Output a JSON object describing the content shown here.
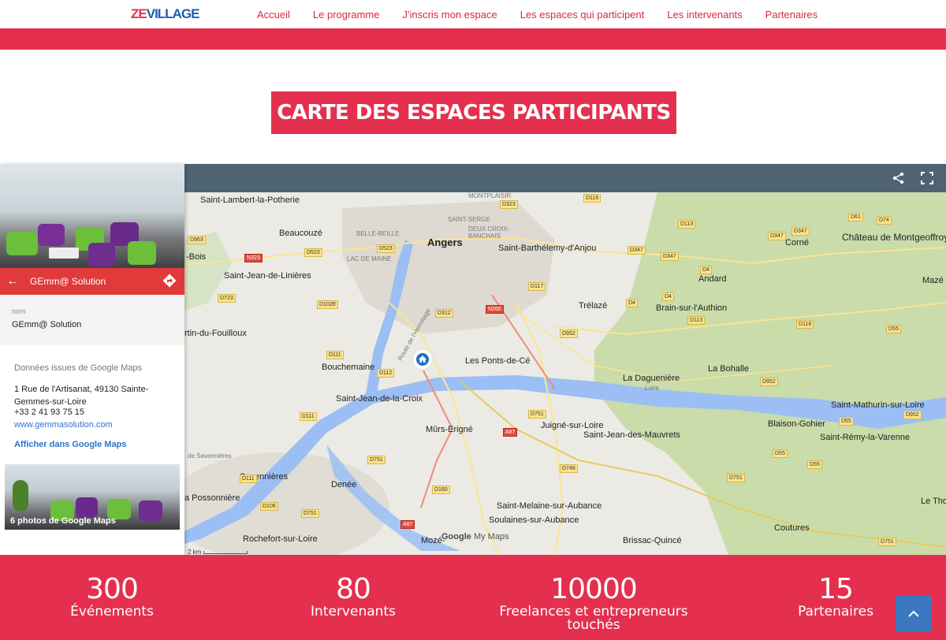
{
  "nav": {
    "logo_left": "ZE",
    "logo_right": "VILLAGE",
    "items": [
      {
        "label": "Accueil"
      },
      {
        "label": "Le programme"
      },
      {
        "label": "J'inscris mon espace"
      },
      {
        "label": "Les espaces qui participent"
      },
      {
        "label": "Les intervenants"
      },
      {
        "label": "Partenaires"
      }
    ]
  },
  "title": "CARTE DES ESPACES PARTICIPANTS",
  "map": {
    "toolbar": {
      "share_icon": "share-icon",
      "fullscreen_icon": "fullscreen-icon"
    },
    "google_logo": "Google",
    "my_maps": "My Maps",
    "scale": "2 km",
    "labels": {
      "angers": "Angers",
      "montplaisir": "MONTPLAISIR",
      "saint_serge": "SAINT-SERGE",
      "deux_croix": "DEUX CROIX-BANCHAIS",
      "belle_beille": "BELLE-BEILLE",
      "lac_de_maine": "LAC DE MAINE",
      "saint_lambert": "Saint-Lambert-la-Potherie",
      "beaucouze": "Beaucouzé",
      "bois": "-Bois",
      "saint_jean_lin": "Saint-Jean-de-Linières",
      "rtin_fouilloux": "rtin-du-Fouilloux",
      "bouchemaine": "Bouchemaine",
      "saint_jean_croix": "Saint-Jean-de-la-Croix",
      "savennieres": "Savennières",
      "possonniere": "a Possonnière",
      "rochefort": "Rochefort-sur-Loire",
      "denee": "Denée",
      "murs": "Mûrs-Erigné",
      "juigne": "Juigné-sur-Loire",
      "ponts_de_ce": "Les Ponts-de-Cé",
      "saint_barth": "Saint-Barthélemy-d'Anjou",
      "trelaze": "Trélazé",
      "saint_jean_mauvrets": "Saint-Jean-des-Mauvrets",
      "saint_melaine": "Saint-Melaine-sur-Aubance",
      "soulaines": "Soulaines-sur-Aubance",
      "moze": "Mozé-",
      "brissac": "Brissac-Quincé",
      "coutures": "Coutures",
      "blaison": "Blaison-Gohier",
      "saint_remy": "Saint-Rémy-la-Varenne",
      "saint_mathurin": "Saint-Mathurin-sur-Loire",
      "la_bohalle": "La Bohalle",
      "la_daguenieres": "La Daguenière",
      "brain": "Brain-sur-l'Authion",
      "andard": "Andard",
      "corne": "Corné",
      "montgeoffroy": "Château de Montgeoffroy",
      "maze": "Mazé",
      "le_thoure": "Le Thoure",
      "route_hermitage": "Route de l'Hermitage",
      "loire": "Loire",
      "sur_savennieres": "de Savennières"
    },
    "roads": {
      "d963": "D963",
      "n323": "N323",
      "d523a": "D523",
      "d523b": "D523",
      "d323": "D323",
      "d116": "D116",
      "d113a": "D113",
      "d113b": "D113",
      "d347a": "D347",
      "d347b": "D347",
      "d347c": "D347",
      "d347d": "D347",
      "d61": "D61",
      "d74": "D74",
      "d723": "D723",
      "d102e": "D102E",
      "d312": "D312",
      "n260": "N260",
      "d117": "D117",
      "d952a": "D952",
      "d4a": "D4",
      "d4b": "D4",
      "d4c": "D4",
      "d118": "D118",
      "d55a": "D55",
      "d55b": "D55",
      "d55c": "D55",
      "d55d": "D55",
      "d111a": "D111",
      "d111b": "D111",
      "d111c": "D111",
      "d112": "D112",
      "d751a": "D751",
      "d751b": "D751",
      "d751c": "D751",
      "d751d": "D751",
      "d751e": "D751",
      "a87a": "A87",
      "a87b": "A87",
      "d748": "D748",
      "d160": "D160",
      "d106": "D106",
      "d952b": "D952",
      "d952c": "D952"
    }
  },
  "panel": {
    "name": "GEmm@ Solution",
    "field_label": "nom",
    "field_value": "GEmm@ Solution",
    "source": "Données issues de Google Maps",
    "address": "1 Rue de l'Artisanat, 49130 Sainte-Gemmes-sur-Loire",
    "phone": "+33 2 41 93 75 15",
    "website": "www.gemmasolution.com",
    "gmaps_link": "Afficher dans Google Maps",
    "photos": "6 photos de Google Maps"
  },
  "stats": [
    {
      "number": "300",
      "label": "Événements"
    },
    {
      "number": "80",
      "label": "Intervenants"
    },
    {
      "number": "10000",
      "label": "Freelances et entrepreneurs touchés"
    },
    {
      "number": "15",
      "label": "Partenaires"
    }
  ],
  "colors": {
    "brand_red": "#e4304e",
    "map_bar": "#4e6473",
    "link_blue": "#2f73c8",
    "top_button": "#3b78c0"
  }
}
